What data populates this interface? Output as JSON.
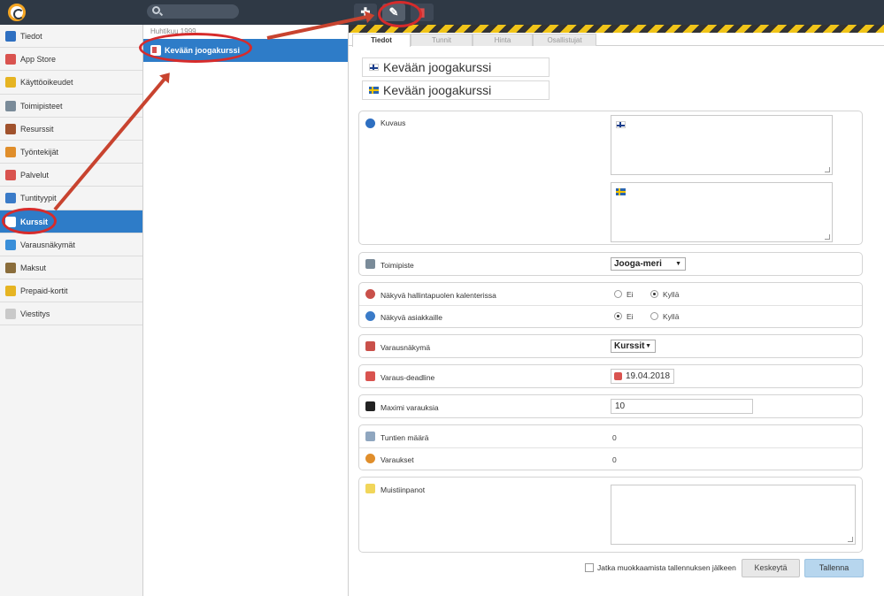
{
  "toolbar": {
    "add_icon": "plus-icon",
    "edit_icon": "pencil-icon",
    "delete_icon": "trash-icon",
    "search_placeholder": ""
  },
  "sidebar": {
    "items": [
      {
        "label": "Tiedot",
        "icon": "info-icon",
        "color": "#2e6fc1"
      },
      {
        "label": "App Store",
        "icon": "app-store-icon",
        "color": "#d9534f"
      },
      {
        "label": "Käyttöoikeudet",
        "icon": "star-icon",
        "color": "#e6b422"
      },
      {
        "label": "Toimipisteet",
        "icon": "building-icon",
        "color": "#7a8b99"
      },
      {
        "label": "Resurssit",
        "icon": "home-icon",
        "color": "#a0522d"
      },
      {
        "label": "Työntekijät",
        "icon": "people-icon",
        "color": "#e08e2b"
      },
      {
        "label": "Palvelut",
        "icon": "calendar-icon",
        "color": "#d9534f"
      },
      {
        "label": "Tuntityypit",
        "icon": "calendar-blue-icon",
        "color": "#3a7bc8"
      },
      {
        "label": "Kurssit",
        "icon": "course-icon",
        "color": "#ffffff",
        "active": true
      },
      {
        "label": "Varausnäkymät",
        "icon": "globe-icon",
        "color": "#3a8fd9"
      },
      {
        "label": "Maksut",
        "icon": "payment-icon",
        "color": "#8a6d3b"
      },
      {
        "label": "Prepaid-kortit",
        "icon": "card-icon",
        "color": "#e6b422"
      },
      {
        "label": "Viestitys",
        "icon": "message-icon",
        "color": "#c9c9c9"
      }
    ]
  },
  "list": {
    "date_header": "Huhtikuu 1999",
    "selected_item": "Kevään joogakurssi"
  },
  "tabs": [
    "Tiedot",
    "Tunnit",
    "Hinta",
    "Osallistujat"
  ],
  "names": {
    "fi": "Kevään joogakurssi",
    "sv": "Kevään joogakurssi"
  },
  "form": {
    "kuvaus_label": "Kuvaus",
    "toimipiste_label": "Toimipiste",
    "toimipiste_value": "Jooga-meri",
    "visible_admin_label": "Näkyvä hallintapuolen kalenterissa",
    "visible_customer_label": "Näkyvä asiakkaille",
    "radio_no": "Ei",
    "radio_yes": "Kyllä",
    "varausnakyma_label": "Varausnäkymä",
    "varausnakyma_value": "Kurssit",
    "deadline_label": "Varaus-deadline",
    "deadline_value": "19.04.2018",
    "max_label": "Maximi varauksia",
    "max_value": "10",
    "tunnit_label": "Tuntien määrä",
    "tunnit_value": "0",
    "varaukset_label": "Varaukset",
    "varaukset_value": "0",
    "muistiinpanot_label": "Muistiinpanot",
    "visible_admin_selected": "Kyllä",
    "visible_customer_selected": "Ei"
  },
  "footer": {
    "continue_label": "Jatka muokkaamista tallennuksen jälkeen",
    "cancel_label": "Keskeytä",
    "save_label": "Tallenna"
  },
  "colors": {
    "accent": "#2e7cc8",
    "topbar": "#2f3945",
    "annotation": "#d62b2b"
  }
}
